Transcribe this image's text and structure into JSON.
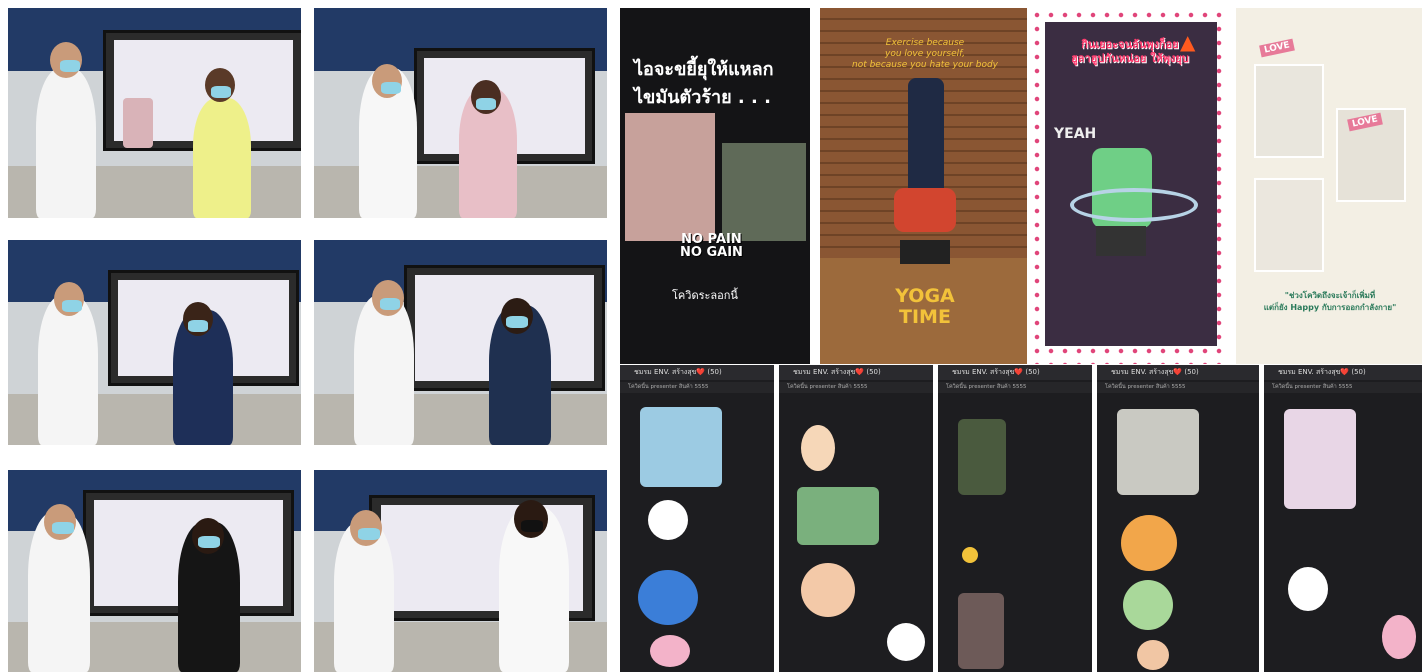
{
  "colors": {
    "wall": "#223a66",
    "chat_bg": "#1d1d20",
    "accent_pink": "#e0457a",
    "yoga_text": "#f2c23a"
  },
  "panels": {
    "video1": {
      "headline_line1": "ไอจะขยี้ยุให้แหลก",
      "headline_line2": "ไขมันตัวร้าย . . .",
      "sticker_line1": "NO PAIN",
      "sticker_line2": "NO GAIN",
      "caption": "โควิดระลอกนี้"
    },
    "video2": {
      "quote_line1": "Exercise because",
      "quote_line2": "you love yourself,",
      "quote_line3": "not because you hate your body",
      "title_line1": "YOGA",
      "title_line2": "TIME"
    },
    "video3": {
      "headline_line1": "กินเยอะจนล้นพุงก็อย",
      "headline_line2": "ฮูลาฮูปกันหน่อย ให้พุงยุบ",
      "side_text": "YEAH"
    },
    "video4": {
      "badge1": "LOVE",
      "badge2": "LOVE",
      "caption_line1": "\"ช่วงโควิดถึงจะเจ้าก็เพิ่มที่",
      "caption_line2": "แต่ก็ยัง Happy กับการออกกำลังกาย\""
    }
  },
  "chat": {
    "group_title": "ชมรม ENV. สร้างสุข❤️ (50)",
    "pinned_notice": "โควิดนี้น presenter สินค้า 5555"
  }
}
